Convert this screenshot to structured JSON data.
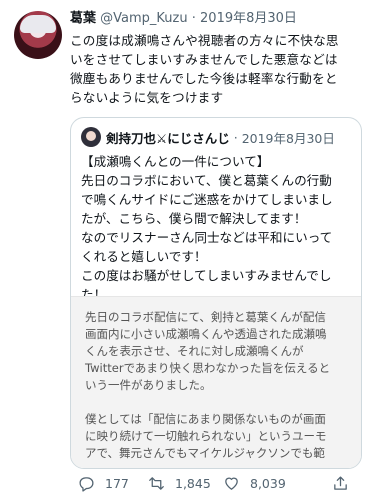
{
  "tweet": {
    "author_name": "葛葉",
    "author_handle": "@Vamp_Kuzu",
    "separator": "·",
    "date": "2019年8月30日",
    "text": "この度は成瀬鳴さんや視聴者の方々に不快な思\nいをさせてしまいすみませんでした悪意などは\n微塵もありませんでした今後は軽率な行動をと\nらないように気をつけます"
  },
  "quote": {
    "author_name": "剣持刀也⚔にじさんじ",
    "separator": "·",
    "date": "2019年8月30日",
    "text": "【成瀬鳴くんとの一件について】\n先日のコラボにおいて、僕と葛葉くんの行動\nで鳴くんサイドにご迷惑をかけてしまいまし\nたが、こちら、僕ら間で解決してます！\nなのでリスナーさん同士などは平和にいって\nくれると嬉しいです！\nこの度はお騒がせしてしまいすみませんでし\nた！",
    "image_text": "先日のコラボ配信にて、剣持と葛葉くんが配信\n画面内に小さい成瀬鳴くんや透過された成瀬鳴\nくんを表示させ、それに対し成瀬鳴くんが\nTwitterであまり快く思わなかった旨を伝えると\nいう一件がありました。\n\n僕としては「配信にあまり関係ないものが画面\nに映り続けて一切触れられない」というユーモ\nアで、舞元さんでもマイケルジャクソンでも範"
  },
  "actions": {
    "reply_count": "177",
    "retweet_count": "1,845",
    "like_count": "8,039"
  },
  "icons": {
    "reply": "reply-icon",
    "retweet": "retweet-icon",
    "like": "heart-icon",
    "share": "share-icon"
  }
}
